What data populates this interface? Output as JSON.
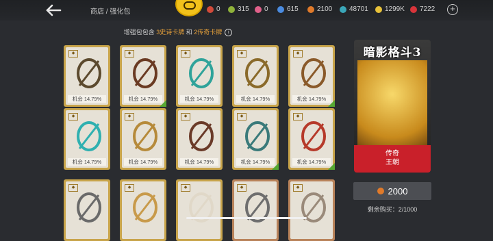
{
  "header": {
    "breadcrumb": "商店 / 强化包",
    "currencies": [
      {
        "icon": "gem-red-icon",
        "value": "0",
        "color": "#d24a3a"
      },
      {
        "icon": "coin-green-icon",
        "value": "315",
        "color": "#8fb23a"
      },
      {
        "icon": "card-pink-icon",
        "value": "0",
        "color": "#e0608a"
      },
      {
        "icon": "token-blue-icon",
        "value": "615",
        "color": "#4a8be0"
      },
      {
        "icon": "gem-orange-icon",
        "value": "2100",
        "color": "#e07a2a"
      },
      {
        "icon": "coin-teal-icon",
        "value": "48701",
        "color": "#3aa6b8"
      },
      {
        "icon": "gold-coin-icon",
        "value": "1299K",
        "color": "#e8c23a"
      },
      {
        "icon": "ruby-icon",
        "value": "7222",
        "color": "#d8343a"
      }
    ]
  },
  "info": {
    "prefix": "增强包包含 ",
    "epic": "3史诗卡牌",
    "mid": " 和 ",
    "legend": "2传奇卡牌"
  },
  "cards": [
    {
      "chance": "机会 14.79%",
      "item": "chakram-icon",
      "checked": false
    },
    {
      "chance": "机会 14.79%",
      "item": "twin-blade-icon",
      "checked": true
    },
    {
      "chance": "机会 14.79%",
      "item": "bow-icon",
      "checked": false
    },
    {
      "chance": "机会 14.79%",
      "item": "sword-icon",
      "checked": false
    },
    {
      "chance": "机会 14.79%",
      "item": "glaive-icon",
      "checked": true
    },
    {
      "chance": "机会 14.79%",
      "item": "dual-daggers-icon",
      "checked": false
    },
    {
      "chance": "机会 14.79%",
      "item": "spiked-ring-icon",
      "checked": false
    },
    {
      "chance": "机会 14.79%",
      "item": "armor-icon",
      "checked": false
    },
    {
      "chance": "机会 14.79%",
      "item": "ornate-armor-icon",
      "checked": true
    },
    {
      "chance": "机会 14.79%",
      "item": "warrior-armor-icon",
      "checked": true
    },
    {
      "chance": "",
      "item": "helmet-icon",
      "checked": false
    },
    {
      "chance": "",
      "item": "crown-icon",
      "checked": false
    },
    {
      "chance": "",
      "item": "mask-icon",
      "checked": false
    },
    {
      "chance": "",
      "item": "shuriken-icon",
      "checked": false
    },
    {
      "chance": "",
      "item": "bomb-icon",
      "checked": false
    }
  ],
  "pack": {
    "title": "暗影格斗3",
    "rarity": "传奇",
    "faction": "王朝"
  },
  "price": "2000",
  "remaining": "剩余购买：2/1000"
}
